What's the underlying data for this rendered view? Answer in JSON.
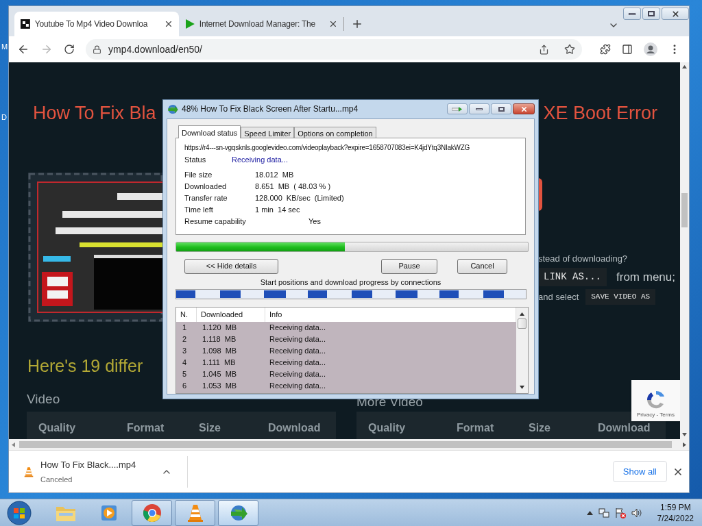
{
  "desktop": {
    "icon_labels": [
      "M",
      "D"
    ]
  },
  "browser": {
    "tabs": [
      {
        "title": "Youtube To Mp4 Video Downloa",
        "kind": "ymp4",
        "selected": true
      },
      {
        "title": "Internet Download Manager: The",
        "kind": "idm",
        "selected": false
      }
    ],
    "toolbar": {
      "forward_disabled": true,
      "url": "ymp4.download/en50/"
    },
    "page": {
      "title_left": "How To Fix Bla",
      "title_right": "XE Boot Error",
      "hint_lines": [
        [
          {
            "kind": "text",
            "text": "stead of downloading?"
          }
        ],
        [
          {
            "kind": "code",
            "text": "LINK AS..."
          },
          {
            "kind": "big",
            "text": "from menu;"
          }
        ],
        [
          {
            "kind": "text",
            "text": "and select"
          },
          {
            "kind": "code_small",
            "text": "SAVE VIDEO AS"
          }
        ]
      ],
      "heading": "Here's 19 differ",
      "sections": [
        {
          "title": "Video",
          "columns": [
            "Quality",
            "Format",
            "Size",
            "Download"
          ]
        },
        {
          "title": "More Video",
          "columns": [
            "Quality",
            "Format",
            "Size",
            "Download"
          ]
        }
      ],
      "recaptcha": "Privacy - Terms"
    },
    "downloads_bar": {
      "file": "How To Fix Black....mp4",
      "status": "Canceled",
      "show_all": "Show all"
    }
  },
  "dialog": {
    "title": "48% How To Fix Black Screen After Startu...mp4",
    "tabs": [
      {
        "label": "Download status",
        "selected": true
      },
      {
        "label": "Speed Limiter",
        "selected": false
      },
      {
        "label": "Options on completion",
        "selected": false
      }
    ],
    "url": "https://r4---sn-vgqsknls.googlevideo.com/videoplayback?expire=1658707083ei=K4jdYtq3NIakWZG",
    "status": {
      "label": "Status",
      "value": "Receiving data..."
    },
    "fields": [
      {
        "label": "File size",
        "value": "18.012  MB",
        "kind": "value"
      },
      {
        "label": "Downloaded",
        "value": "8.651  MB  ( 48.03 % )",
        "kind": "value"
      },
      {
        "label": "Transfer rate",
        "value": "128.000  KB/sec  (Limited)",
        "kind": "value"
      },
      {
        "label": "Time left",
        "value": "1 min  14 sec",
        "kind": "value"
      },
      {
        "label": "Resume capability",
        "value": "Yes",
        "kind": "flag"
      }
    ],
    "progress": {
      "level": 0.4803
    },
    "buttons": [
      "<< Hide details",
      "Pause",
      "Cancel"
    ],
    "connections_caption": "Start positions and download progress by connections",
    "table": {
      "columns": [
        "N.",
        "Downloaded",
        "Info"
      ],
      "rows": [
        {
          "n": "1",
          "downloaded": "1.120  MB",
          "info": "Receiving data..."
        },
        {
          "n": "2",
          "downloaded": "1.118  MB",
          "info": "Receiving data..."
        },
        {
          "n": "3",
          "downloaded": "1.098  MB",
          "info": "Receiving data..."
        },
        {
          "n": "4",
          "downloaded": "1.111  MB",
          "info": "Receiving data..."
        },
        {
          "n": "5",
          "downloaded": "1.045  MB",
          "info": "Receiving data..."
        },
        {
          "n": "6",
          "downloaded": "1.053  MB",
          "info": "Receiving data..."
        }
      ]
    }
  },
  "taskbar": {
    "apps": [
      {
        "kind": "folder",
        "running": false,
        "active": false
      },
      {
        "kind": "media",
        "running": false,
        "active": false
      },
      {
        "kind": "chrome",
        "running": true,
        "active": false
      },
      {
        "kind": "vlc",
        "running": true,
        "active": false
      },
      {
        "kind": "idm",
        "running": true,
        "active": true
      }
    ],
    "time": "1:59 PM",
    "date": "7/24/2022"
  }
}
